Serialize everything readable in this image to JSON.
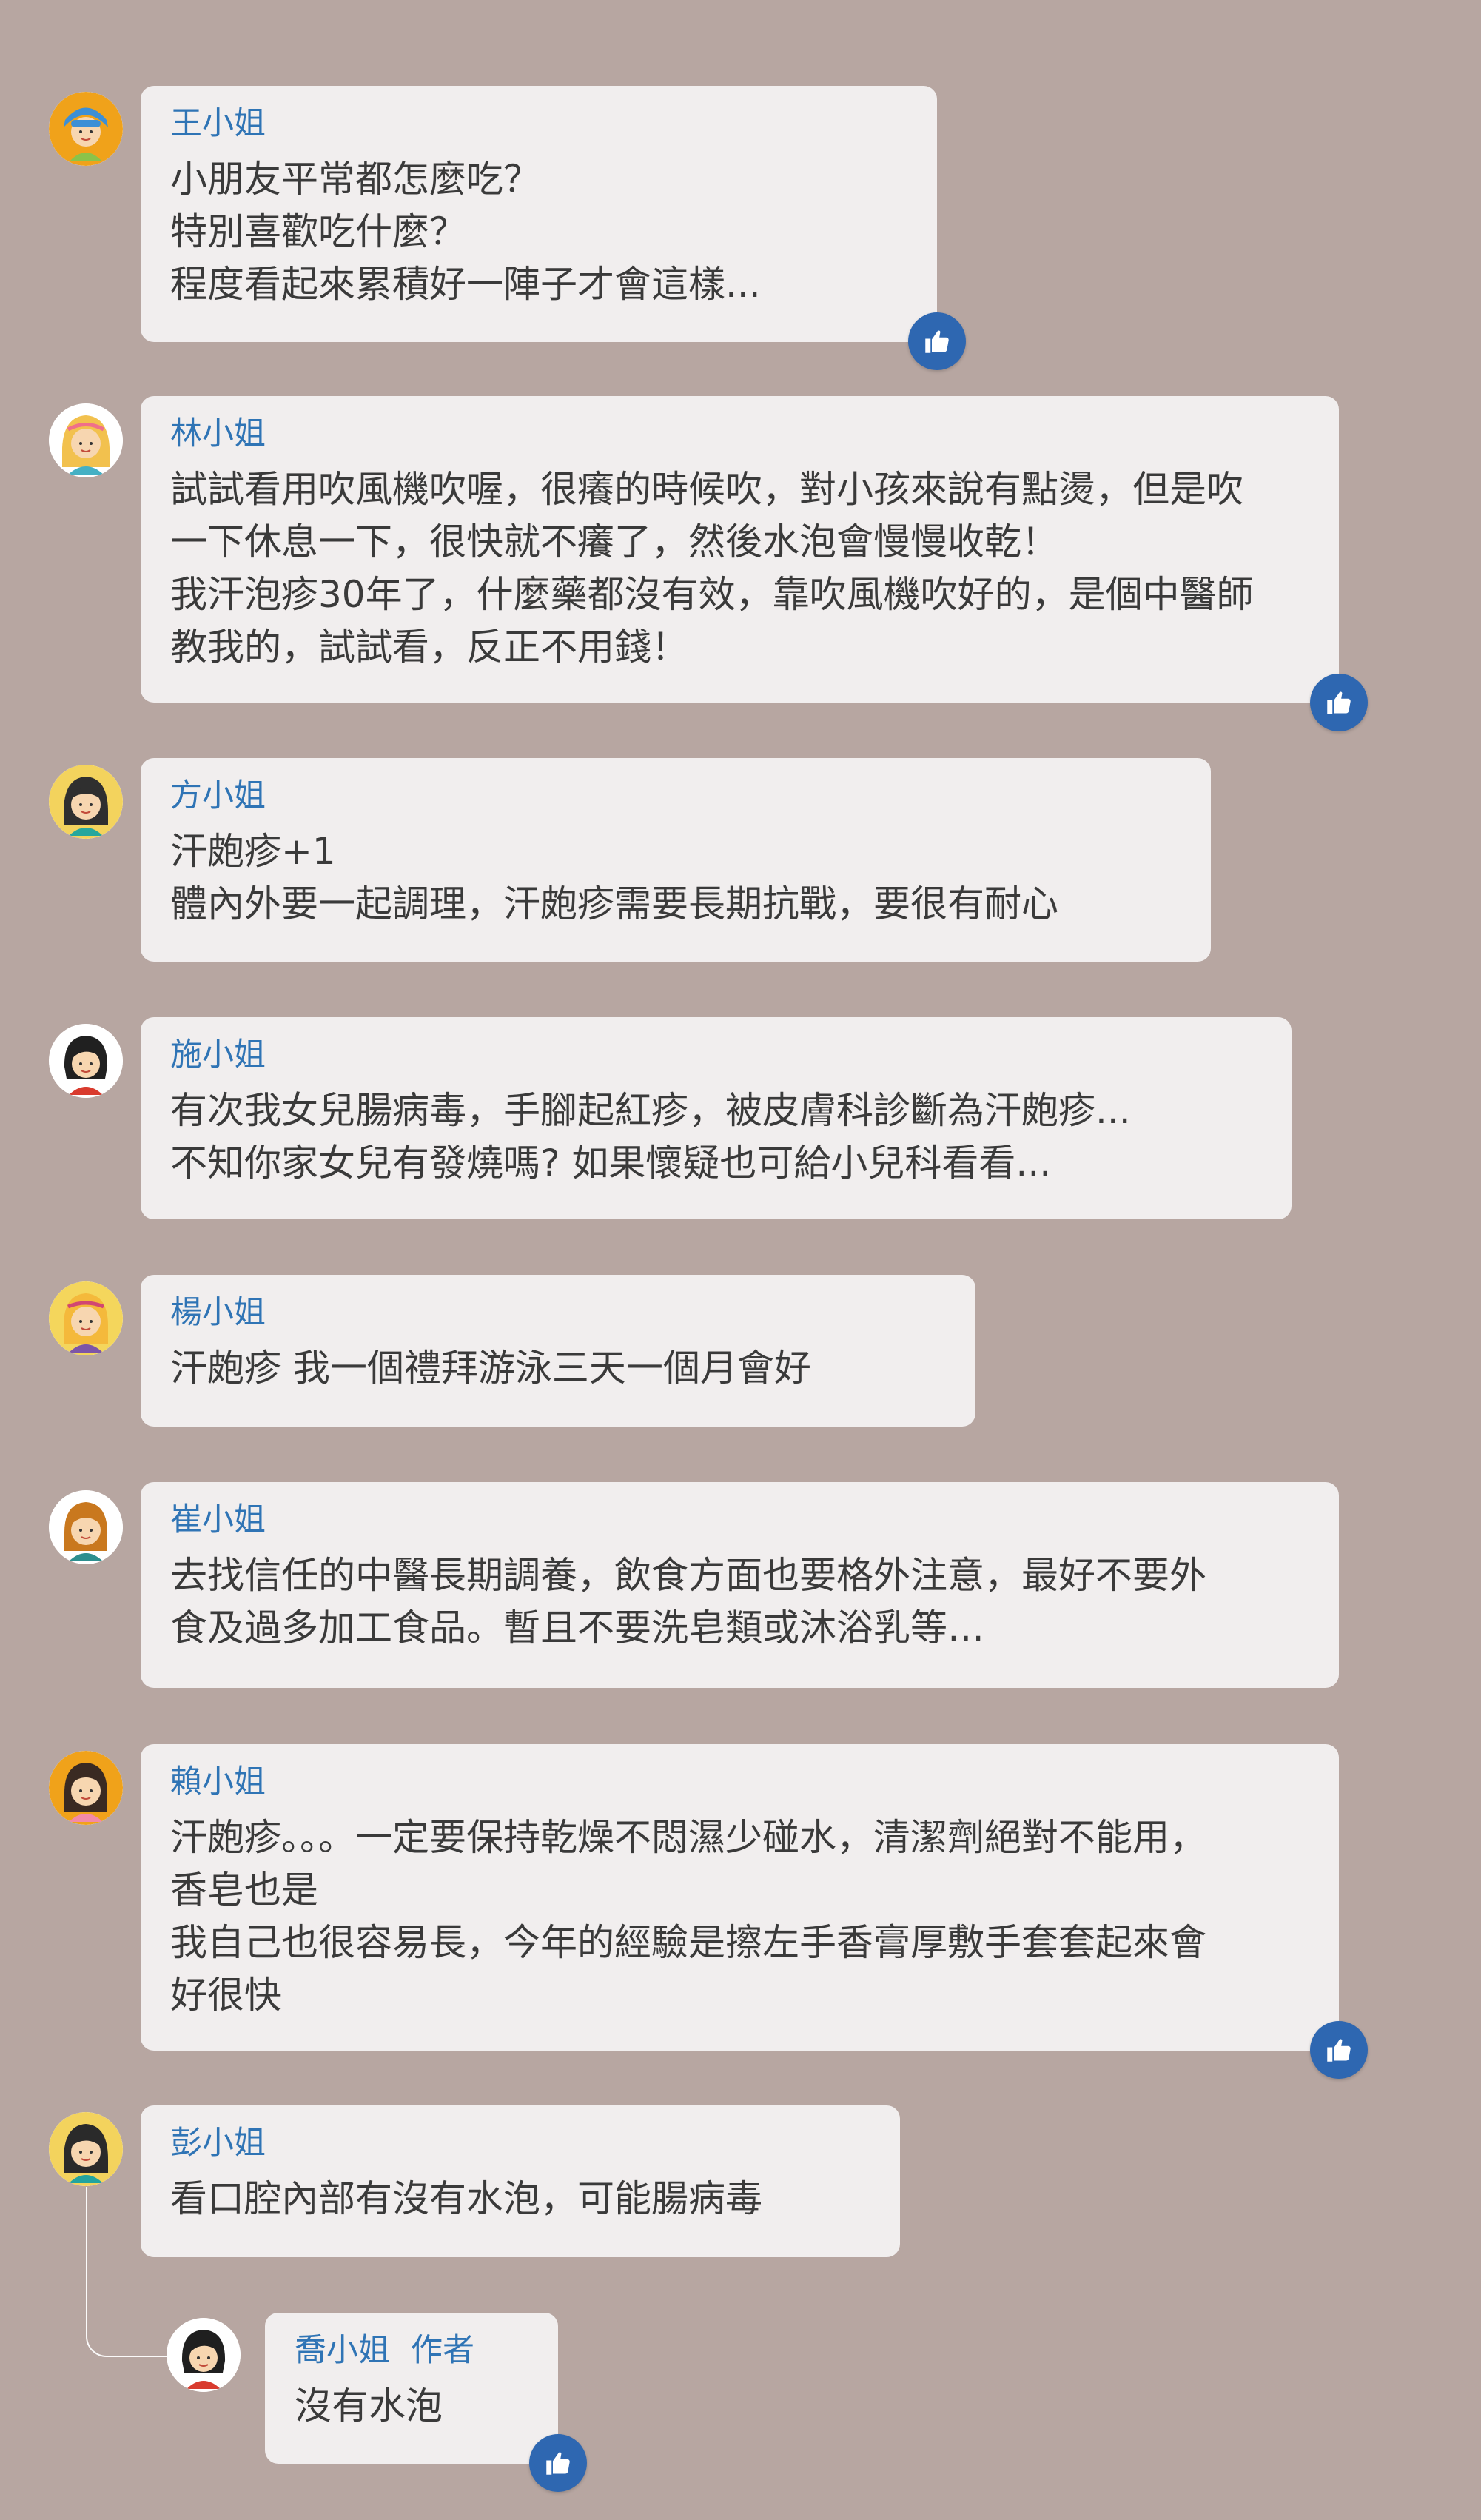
{
  "comments": [
    {
      "author": "王小姐",
      "lines": [
        "小朋友平常都怎麼吃？",
        "特別喜歡吃什麼？",
        "程度看起來累積好一陣子才會這樣..."
      ],
      "avatar": "girl-blue-cap-avatar"
    },
    {
      "author": "林小姐",
      "lines": [
        "試試看用吹風機吹喔，很癢的時候吹，對小孩來說有點燙，但是吹",
        "一下休息一下，很快就不癢了，然後水泡會慢慢收乾！",
        "我汗泡疹30年了，什麼藥都沒有效，靠吹風機吹好的，是個中醫師",
        "教我的，試試看，反正不用錢！"
      ],
      "avatar": "blonde-girl-headband-avatar"
    },
    {
      "author": "方小姐",
      "lines": [
        "汗皰疹+1",
        "體內外要一起調理，汗皰疹需要長期抗戰，要很有耐心"
      ],
      "avatar": "dark-hair-girl-avatar"
    },
    {
      "author": "施小姐",
      "lines": [
        "有次我女兒腸病毒，手腳起紅疹，被皮膚科診斷為汗皰疹...",
        "不知你家女兒有發燒嗎? 如果懷疑也可給小兒科看看..."
      ],
      "avatar": "black-hair-woman-avatar"
    },
    {
      "author": "楊小姐",
      "lines": [
        "汗皰疹 我一個禮拜游泳三天一個月會好"
      ],
      "avatar": "blonde-purple-shirt-avatar"
    },
    {
      "author": "崔小姐",
      "lines": [
        "去找信任的中醫長期調養，飲食方面也要格外注意，最好不要外",
        "食及過多加工食品。暫且不要洗皂類或沐浴乳等…"
      ],
      "avatar": "brown-hair-girl-avatar"
    },
    {
      "author": "賴小姐",
      "lines": [
        "汗皰疹。。。一定要保持乾燥不悶濕少碰水，清潔劑絕對不能用，",
        "香皂也是",
        "我自己也很容易長，今年的經驗是擦左手香膏厚敷手套套起來會",
        "好很快"
      ],
      "avatar": "pink-shirt-girl-avatar"
    },
    {
      "author": "彭小姐",
      "lines": [
        "看口腔內部有沒有水泡，可能腸病毒"
      ],
      "avatar": "teal-shirt-woman-avatar"
    }
  ],
  "reply": {
    "author": "喬小姐",
    "author_tag": "作者",
    "lines": [
      "沒有水泡"
    ],
    "avatar": "red-shirt-woman-avatar"
  },
  "icons": {
    "like": "thumbs-up-icon"
  },
  "colors": {
    "background": "#b7a6a1",
    "bubble": "#f1eeee",
    "author_name": "#2f74b5",
    "text": "#3a3a3a",
    "like_badge": "#2e67b1"
  }
}
